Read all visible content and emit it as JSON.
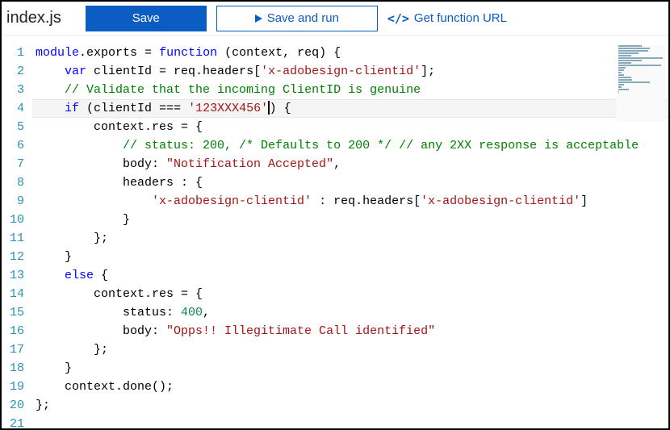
{
  "filename": "index.js",
  "toolbar": {
    "save_label": "Save",
    "save_run_label": "Save and run",
    "get_url_label": "Get function URL",
    "url_icon_glyph": "</>"
  },
  "code": {
    "lines": [
      {
        "n": 1,
        "tokens": [
          [
            "kw",
            "module"
          ],
          [
            "pun",
            "."
          ],
          [
            "",
            "exports "
          ],
          [
            "pun",
            "= "
          ],
          [
            "kw",
            "function"
          ],
          [
            "",
            " (context, req) {"
          ]
        ]
      },
      {
        "n": 2,
        "tokens": [
          [
            "",
            "    "
          ],
          [
            "kw",
            "var"
          ],
          [
            "",
            " clientId = req.headers["
          ],
          [
            "str",
            "'x-adobesign-clientid'"
          ],
          [
            "",
            "];"
          ]
        ]
      },
      {
        "n": 3,
        "tokens": [
          [
            "",
            "    "
          ],
          [
            "com",
            "// Validate that the incoming ClientID is genuine"
          ]
        ]
      },
      {
        "n": 4,
        "tokens": [
          [
            "",
            "    "
          ],
          [
            "kw",
            "if"
          ],
          [
            "",
            " (clientId "
          ],
          [
            "pun",
            "==="
          ],
          [
            "",
            " "
          ],
          [
            "str",
            "'123XXX456'"
          ]
        ],
        "cursor": true,
        "tail": [
          [
            "",
            "",
            "",
            ") {"
          ]
        ],
        "current": true
      },
      {
        "n": 5,
        "tokens": [
          [
            "",
            "        context.res = {"
          ]
        ]
      },
      {
        "n": 6,
        "tokens": [
          [
            "",
            "            "
          ],
          [
            "com",
            "// status: 200, /* Defaults to 200 */ // any 2XX response is acceptable"
          ]
        ]
      },
      {
        "n": 7,
        "tokens": [
          [
            "",
            "            body: "
          ],
          [
            "str",
            "\"Notification Accepted\""
          ],
          [
            "",
            ","
          ]
        ]
      },
      {
        "n": 8,
        "tokens": [
          [
            "",
            "            headers : {"
          ]
        ]
      },
      {
        "n": 9,
        "tokens": [
          [
            "",
            "                "
          ],
          [
            "str",
            "'x-adobesign-clientid'"
          ],
          [
            "",
            " : req.headers["
          ],
          [
            "str",
            "'x-adobesign-clientid'"
          ],
          [
            "",
            "]"
          ]
        ]
      },
      {
        "n": 10,
        "tokens": [
          [
            "",
            "            }"
          ]
        ]
      },
      {
        "n": 11,
        "tokens": [
          [
            "",
            "        };"
          ]
        ]
      },
      {
        "n": 12,
        "tokens": [
          [
            "",
            "    }"
          ]
        ]
      },
      {
        "n": 13,
        "tokens": [
          [
            "",
            "    "
          ],
          [
            "kw",
            "else"
          ],
          [
            "",
            " {"
          ]
        ]
      },
      {
        "n": 14,
        "tokens": [
          [
            "",
            "        context.res = {"
          ]
        ]
      },
      {
        "n": 15,
        "tokens": [
          [
            "",
            "            status: "
          ],
          [
            "num",
            "400"
          ],
          [
            "",
            ","
          ]
        ]
      },
      {
        "n": 16,
        "tokens": [
          [
            "",
            "            body: "
          ],
          [
            "str",
            "\"Opps!! Illegitimate Call identified\""
          ]
        ]
      },
      {
        "n": 17,
        "tokens": [
          [
            "",
            "        };"
          ]
        ]
      },
      {
        "n": 18,
        "tokens": [
          [
            "",
            "    }"
          ]
        ]
      },
      {
        "n": 19,
        "tokens": [
          [
            "",
            "    context.done();"
          ]
        ]
      },
      {
        "n": 20,
        "tokens": [
          [
            "",
            "};"
          ]
        ]
      },
      {
        "n": 21,
        "tokens": [
          [
            "",
            ""
          ]
        ]
      }
    ]
  }
}
